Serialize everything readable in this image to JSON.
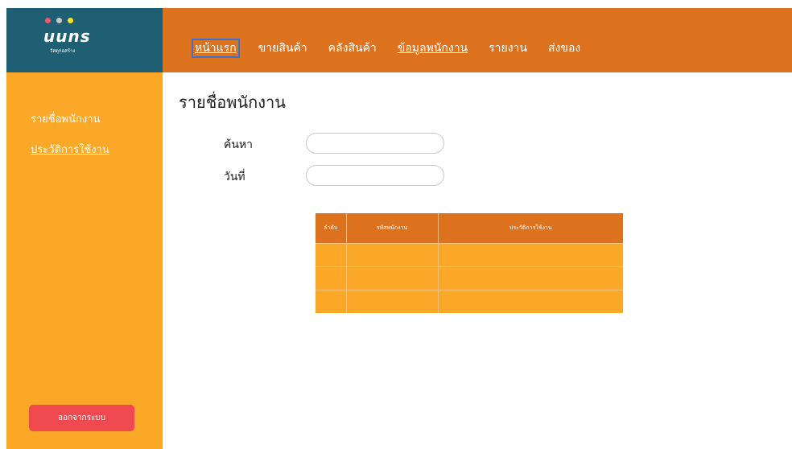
{
  "colors": {
    "brand_bg": "#1f5f73",
    "header_bg": "#dc711e",
    "sidebar_bg": "#fba828",
    "table_header_bg": "#dc711e",
    "table_body_bg": "#fba828",
    "logout_bg": "#ef4a4f",
    "active_nav_border": "#3b6fd0",
    "window_dots": [
      "#ef5b6e",
      "#c9c9c9",
      "#f5e12a"
    ]
  },
  "brand": {
    "logo_text": "uuns",
    "tagline": "วัสดุก่อสร้าง"
  },
  "nav": {
    "items": [
      {
        "label": "หน้าแรก"
      },
      {
        "label": "ขายสินค้า"
      },
      {
        "label": "คลังสินค้า"
      },
      {
        "label": "ข้อมูลพนักงาน"
      },
      {
        "label": "รายงาน"
      },
      {
        "label": "ส่งของ"
      }
    ]
  },
  "sidebar": {
    "items": [
      {
        "label": "รายชื่อพนักงาน"
      },
      {
        "label": "ประวัติการใช้งาน"
      }
    ],
    "logout_label": "ออกจากระบบ"
  },
  "main": {
    "title": "รายชื่อพนักงาน",
    "search_label": "ค้นหา",
    "search_value": "",
    "date_label": "วันที่",
    "date_value": ""
  },
  "table": {
    "headers": [
      "ลำดับ",
      "รหัสพนักงาน",
      "ประวัติการใช้งาน"
    ],
    "rows": [
      [
        "",
        "",
        ""
      ],
      [
        "",
        "",
        ""
      ],
      [
        "",
        "",
        ""
      ]
    ]
  }
}
